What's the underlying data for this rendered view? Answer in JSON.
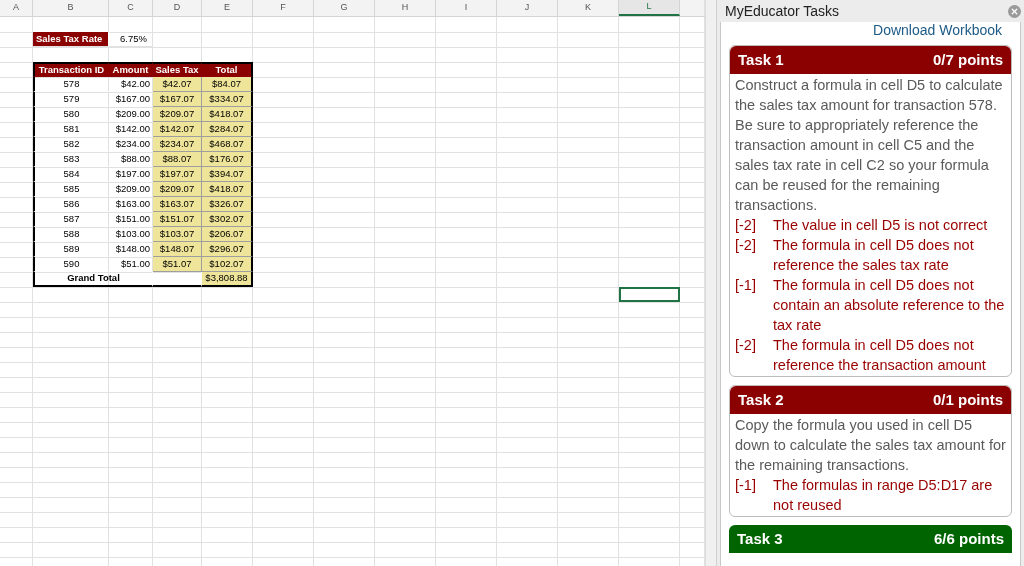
{
  "spreadsheet": {
    "columns": [
      {
        "label": "A",
        "selected": false
      },
      {
        "label": "B",
        "selected": false
      },
      {
        "label": "C",
        "selected": false
      },
      {
        "label": "D",
        "selected": false
      },
      {
        "label": "E",
        "selected": false
      },
      {
        "label": "F",
        "selected": false
      },
      {
        "label": "G",
        "selected": false
      },
      {
        "label": "H",
        "selected": false
      },
      {
        "label": "I",
        "selected": false
      },
      {
        "label": "J",
        "selected": false
      },
      {
        "label": "K",
        "selected": false
      },
      {
        "label": "L",
        "selected": true
      }
    ],
    "rate": {
      "label": "Sales Tax Rate",
      "value": "6.75%"
    },
    "table": {
      "headers": [
        "Transaction ID",
        "Amount",
        "Sales Tax",
        "Total"
      ],
      "rows": [
        [
          "578",
          "$42.00",
          "$42.07",
          "$84.07"
        ],
        [
          "579",
          "$167.00",
          "$167.07",
          "$334.07"
        ],
        [
          "580",
          "$209.00",
          "$209.07",
          "$418.07"
        ],
        [
          "581",
          "$142.00",
          "$142.07",
          "$284.07"
        ],
        [
          "582",
          "$234.00",
          "$234.07",
          "$468.07"
        ],
        [
          "583",
          "$88.00",
          "$88.07",
          "$176.07"
        ],
        [
          "584",
          "$197.00",
          "$197.07",
          "$394.07"
        ],
        [
          "585",
          "$209.00",
          "$209.07",
          "$418.07"
        ],
        [
          "586",
          "$163.00",
          "$163.07",
          "$326.07"
        ],
        [
          "587",
          "$151.00",
          "$151.07",
          "$302.07"
        ],
        [
          "588",
          "$103.00",
          "$103.07",
          "$206.07"
        ],
        [
          "589",
          "$148.00",
          "$148.07",
          "$296.07"
        ],
        [
          "590",
          "$51.00",
          "$51.07",
          "$102.07"
        ]
      ],
      "grand_total": {
        "label": "Grand Total",
        "value": "$3,808.88"
      }
    }
  },
  "panel": {
    "title": "MyEducator Tasks",
    "link": "Download Workbook",
    "tasks": [
      {
        "title": "Task 1",
        "points": "0/7 points",
        "color": "#8b0000",
        "description": "Construct a formula in cell D5 to calculate the sales tax amount for transaction 578. Be sure to appropriately reference the transaction amount in cell C5 and the sales tax rate in cell C2 so your formula can be reused for the remaining transactions.",
        "deductions": [
          {
            "points": "[-2]",
            "text": "The value in cell D5 is not correct"
          },
          {
            "points": "[-2]",
            "text": "The formula in cell D5 does not reference the sales tax rate"
          },
          {
            "points": "[-1]",
            "text": "The formula in cell D5 does not contain an absolute reference to the tax rate"
          },
          {
            "points": "[-2]",
            "text": "The formula in cell D5 does not reference the transaction amount"
          }
        ]
      },
      {
        "title": "Task 2",
        "points": "0/1 points",
        "color": "#8b0000",
        "description": "Copy the formula you used in cell D5 down to calculate the sales tax amount for the remaining transactions.",
        "deductions": [
          {
            "points": "[-1]",
            "text": "The formulas in range D5:D17 are not reused"
          }
        ]
      },
      {
        "title": "Task 3",
        "points": "6/6 points",
        "color": "#006400"
      }
    ]
  }
}
